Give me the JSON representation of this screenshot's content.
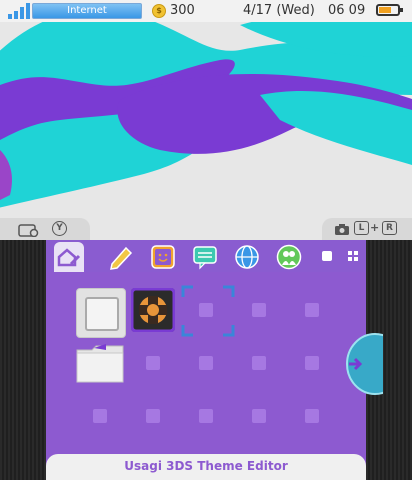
{
  "status": {
    "network_label": "Internet",
    "coin_glyph": "$",
    "coins": "300",
    "date": "4/17 (Wed)",
    "time": "06 09"
  },
  "shoulders": {
    "left_button": "Y",
    "right_buttons": [
      "L",
      "+",
      "R"
    ]
  },
  "bottom_bar": {
    "text": "Usagi   3DS Theme Editor"
  },
  "colors": {
    "theme_purple": "#8d5ad0",
    "accent_teal": "#20d0d0",
    "accent_violet": "#7b3fd6"
  },
  "icons": [
    "camera-icon",
    "home-settings-icon",
    "pencil-icon",
    "smiley-icon",
    "chat-icon",
    "globe-icon",
    "friends-icon",
    "grid-icon",
    "folder-icon",
    "arrow-right-icon"
  ]
}
